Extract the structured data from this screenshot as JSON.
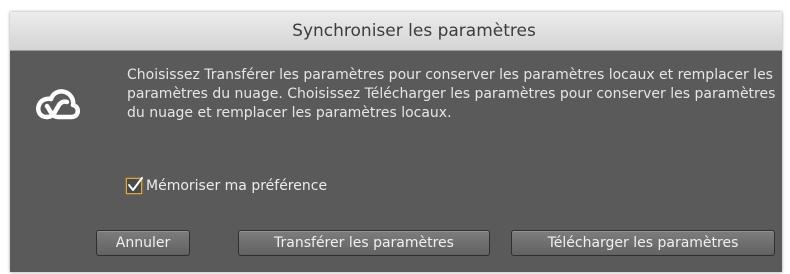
{
  "dialog": {
    "title": "Synchroniser les paramètres",
    "message": "Choisissez Transférer les paramètres pour conserver les paramètres locaux et remplacer les paramètres du nuage. Choisissez Télécharger les paramètres pour conserver les paramètres du nuage et remplacer les paramètres locaux.",
    "remember_label": "Mémoriser ma préférence",
    "remember_checked": true,
    "icon": "creative-cloud-icon"
  },
  "buttons": {
    "cancel_label": "Annuler",
    "upload_label": "Transférer les paramètres",
    "download_label": "Télécharger les paramètres"
  },
  "colors": {
    "dialog_background": "#5a5a5a",
    "titlebar_background": "#dcdcdc",
    "checkbox_focus": "#d9a84a"
  }
}
